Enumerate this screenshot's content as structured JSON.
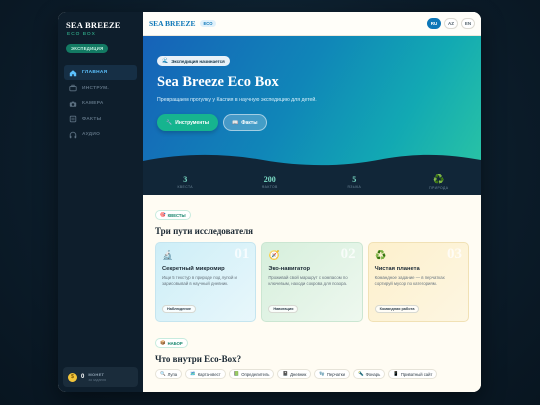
{
  "sidebar": {
    "brand_title": "SEA BREEZE",
    "brand_sub": "ECO BOX",
    "brand_badge": "ЭКСПЕДИЦИЯ",
    "items": [
      {
        "label": "ГЛАВНАЯ",
        "icon": "home-icon",
        "active": true
      },
      {
        "label": "ИНСТРУМ.",
        "icon": "tools-icon",
        "active": false
      },
      {
        "label": "КАМЕРА",
        "icon": "camera-icon",
        "active": false
      },
      {
        "label": "ФАКТЫ",
        "icon": "book-icon",
        "active": false
      },
      {
        "label": "АУДИО",
        "icon": "headphones-icon",
        "active": false
      }
    ],
    "coins": {
      "value": "0",
      "label": "МОНЕТ",
      "sub": "за задания"
    }
  },
  "topbar": {
    "title": "SEA BREEZE",
    "badge": "ECO",
    "languages": [
      {
        "code": "RU",
        "active": true
      },
      {
        "code": "AZ",
        "active": false
      },
      {
        "code": "EN",
        "active": false
      }
    ]
  },
  "hero": {
    "tag": "Экспедиция начинается",
    "title": "Sea Breeze Eco Box",
    "description": "Превращаем прогулку у Каспия в научную экспедицию для детей.",
    "primary_button": "Инструменты",
    "secondary_button": "Факты"
  },
  "stats": [
    {
      "value": "3",
      "label": "КВЕСТА"
    },
    {
      "value": "200",
      "label": "ФАКТОВ"
    },
    {
      "value": "5",
      "label": "ЯЗЫКА"
    },
    {
      "value": "♻️",
      "label": "ПРИРОДА"
    }
  ],
  "quests": {
    "pill": "КВЕСТЫ",
    "title": "Три пути исследователя",
    "cards": [
      {
        "num": "01",
        "icon": "🔬",
        "title": "Секретный микромир",
        "desc": "Ищи 5 текстур в природе под лупой и зарисовывай в научный дневник.",
        "chip": "Наблюдение"
      },
      {
        "num": "02",
        "icon": "🧭",
        "title": "Эко-навигатор",
        "desc": "Проживай свой маршрут с компасом по ключевым, находи сокрова для позора.",
        "chip": "Навигация"
      },
      {
        "num": "03",
        "icon": "♻️",
        "title": "Чистая планета",
        "desc": "Командное задание — в перчатках сортируй мусор по категориям.",
        "chip": "Командная работа"
      }
    ]
  },
  "kit": {
    "pill": "НАБОР",
    "title": "Что внутри Eco-Box?",
    "items": [
      {
        "icon": "🔍",
        "label": "Лупа"
      },
      {
        "icon": "🗺️",
        "label": "Карта-квест"
      },
      {
        "icon": "📗",
        "label": "Определитель"
      },
      {
        "icon": "📓",
        "label": "Дневник"
      },
      {
        "icon": "🧤",
        "label": "Перчатки"
      },
      {
        "icon": "🔦",
        "label": "Фонарь"
      },
      {
        "icon": "📱",
        "label": "Приватный сайт"
      }
    ]
  },
  "colors": {
    "accent": "#0d77b8",
    "green": "#16b48f",
    "sidebar": "#0e1e2c"
  }
}
